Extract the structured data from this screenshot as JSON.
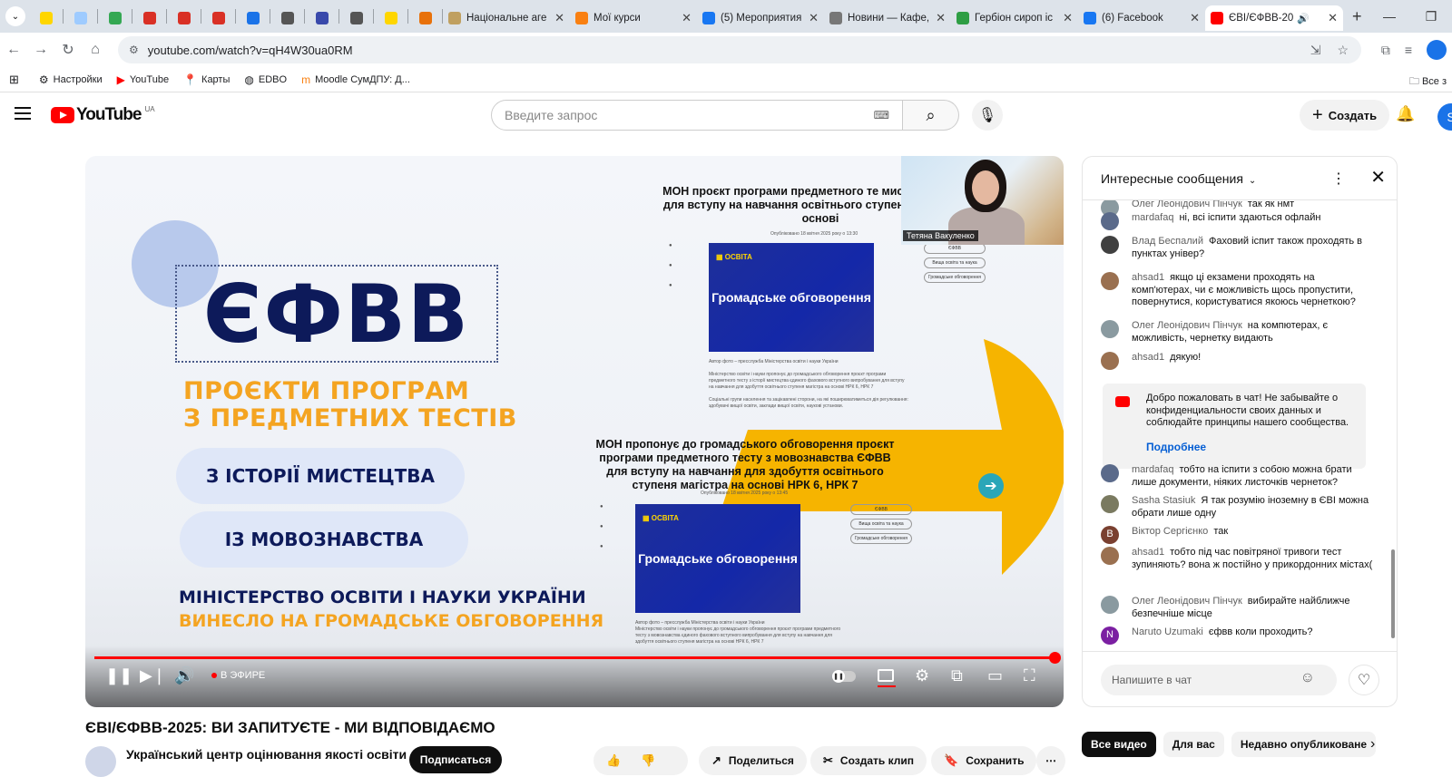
{
  "browser": {
    "tabs": [
      {
        "title": "",
        "icon": "ukraine-icon",
        "color": "#ffd600"
      },
      {
        "title": "",
        "icon": "doc-icon",
        "color": "#9ecbff"
      },
      {
        "title": "",
        "icon": "drive-icon",
        "color": "#34a853"
      },
      {
        "title": "",
        "icon": "gmail-icon",
        "color": "#d93025"
      },
      {
        "title": "",
        "icon": "gmail-icon",
        "color": "#d93025"
      },
      {
        "title": "",
        "icon": "gmail-icon",
        "color": "#d93025"
      },
      {
        "title": "",
        "icon": "ukraine-icon",
        "color": "#1a73e8"
      },
      {
        "title": "",
        "icon": "pen-icon",
        "color": "#555555"
      },
      {
        "title": "",
        "icon": "app-icon",
        "color": "#3949ab"
      },
      {
        "title": "",
        "icon": "globe-icon",
        "color": "#555555"
      },
      {
        "title": "",
        "icon": "ukraine-icon",
        "color": "#ffd600"
      },
      {
        "title": "",
        "icon": "grid-icon",
        "color": "#e8710a"
      },
      {
        "title": "Національне аге",
        "icon": "emblem-icon",
        "color": "#c0a060"
      },
      {
        "title": "Мої курси",
        "icon": "moodle-icon",
        "color": "#f98012"
      },
      {
        "title": "(5) Мероприятия",
        "icon": "facebook-icon",
        "color": "#1877f2"
      },
      {
        "title": "Новини — Кафе,",
        "icon": "site-icon",
        "color": "#777777"
      },
      {
        "title": "Гербіон сироп ic",
        "icon": "pharm-icon",
        "color": "#2e9e44"
      },
      {
        "title": "(6) Facebook",
        "icon": "facebook-icon",
        "color": "#1877f2"
      },
      {
        "title": "ЄВІ/ЄФВВ-20",
        "icon": "youtube-icon",
        "color": "#ff0000"
      }
    ],
    "url": "youtube.com/watch?v=qH4W30ua0RM",
    "bookmarks": [
      {
        "label": "Настройки",
        "icon": "gear-icon"
      },
      {
        "label": "YouTube",
        "icon": "youtube-icon"
      },
      {
        "label": "Карты",
        "icon": "maps-icon"
      },
      {
        "label": "EDBO",
        "icon": "globe-icon"
      },
      {
        "label": "Moodle СумДПУ: Д...",
        "icon": "moodle-icon"
      }
    ],
    "bookmarks_all": "Все з",
    "profile_letter": ""
  },
  "youtube": {
    "logo_text": "YouTube",
    "region": "UA",
    "search_placeholder": "Введите запрос",
    "create_label": "Создать",
    "avatar_letter": "S"
  },
  "slide": {
    "efvv": "ЄФВВ",
    "title_line1": "ПРОЄКТИ ПРОГРАМ",
    "title_line2": "З ПРЕДМЕТНИХ ТЕСТІВ",
    "pill1": "З ІСТОРІЇ МИСТЕЦТВА",
    "pill2": "ІЗ МОВОЗНАВСТВА",
    "ministry_line1": "МІНІСТЕРСТВО ОСВІТИ І НАУКИ УКРАЇНИ",
    "ministry_line2": "ВИНЕСЛО НА ГРОМАДСЬКЕ ОБГОВОРЕННЯ",
    "article1_title": "МОН проєкт програми предметного те мистецтва ЄФВВ для вступу на навчання освітнього ступеня магістра на основі",
    "article2_title": "МОН пропонує до громадського обговорення проєкт програми предметного тесту з мовознавства ЄФВВ для вступу на навчання для здобуття освітнього ступеня магістра на основі НРК 6, НРК 7",
    "thumb_text": "Громадське обговорення",
    "webcam_name": "Тетяна Вакуленко"
  },
  "player": {
    "live_label": "В ЭФИРЕ",
    "progress": 1.0
  },
  "video": {
    "title": "ЄВІ/ЄФВВ-2025: ВИ ЗАПИТУЄТЕ - МИ ВІДПОВІДАЄМО",
    "channel": "Український центр оцінювання якості освіти",
    "subscribe": "Подписаться",
    "share": "Поделиться",
    "clip": "Создать клип",
    "save": "Сохранить"
  },
  "chat": {
    "header": "Интересные сообщения",
    "messages": [
      {
        "author": "Олег Леонідович Пінчук",
        "text": "так як нмт",
        "color": "#8a9aa0"
      },
      {
        "author": "mardafaq",
        "text": "ні, всі іспити здаються офлайн",
        "color": "#5a6a8a"
      },
      {
        "author": "Влад Беспалий",
        "text": "Фаховий іспит також проходять в пунктах універ?",
        "color": "#404040"
      },
      {
        "author": "ahsad1",
        "text": "якщо ці екзамени проходять на комп'ютерах, чи є можливість щось пропустити, повернутися, користуватися якоюсь чернеткою?",
        "color": "#9a7050"
      },
      {
        "author": "Олег Леонідович Пінчук",
        "text": "на компютерах, є можливість, чернетку видають",
        "color": "#8a9aa0"
      },
      {
        "author": "ahsad1",
        "text": "дякую!",
        "color": "#9a7050"
      },
      {
        "author": "mardafaq",
        "text": "тобто на іспити з собою можна брати лише документи, ніяких листочків чернеток?",
        "color": "#5a6a8a"
      },
      {
        "author": "Sasha Stasiuk",
        "text": "Я так розумію іноземну в ЄВІ можна обрати лише одну",
        "color": "#7a7a60"
      },
      {
        "author": "Віктор Сергієнко",
        "text": "так",
        "color": "#7a4030",
        "letter": "В"
      },
      {
        "author": "ahsad1",
        "text": "тобто під час повітряної тривоги тест зупиняють? вона ж постійно у прикордонних містах(",
        "color": "#9a7050"
      },
      {
        "author": "Олег Леонідович Пінчук",
        "text": "вибирайте найближче безпечніше місце",
        "color": "#8a9aa0"
      },
      {
        "author": "Naruto Uzumaki",
        "text": "єфвв коли проходить?",
        "color": "#7b1fa2",
        "letter": "N"
      }
    ],
    "welcome_text": "Добро пожаловать в чат! Не забывайте о конфиденциальности своих данных и соблюдайте принципы нашего сообщества.",
    "welcome_link": "Подробнее",
    "input_placeholder": "Напишите в чат"
  },
  "chips": [
    "Все видео",
    "Для вас",
    "Недавно опубликоване"
  ]
}
